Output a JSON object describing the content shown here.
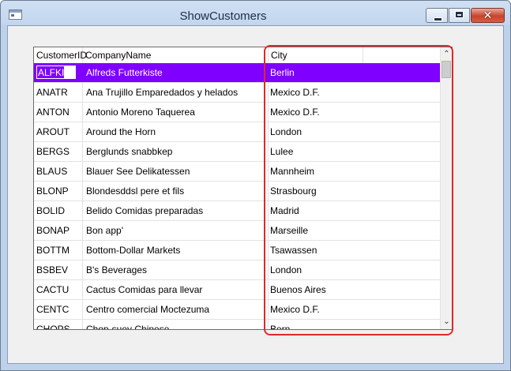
{
  "window": {
    "title": "ShowCustomers",
    "close_glyph": "✕",
    "icons": [
      "app-icon",
      "minimize-icon",
      "maximize-icon",
      "close-icon",
      "chevron-up-icon",
      "chevron-down-icon"
    ]
  },
  "grid": {
    "columns": [
      "CustomerID",
      "CompanyName",
      "City"
    ],
    "selected_color": "#7f00ff",
    "rows": [
      {
        "id": "ALFKI",
        "company": "Alfreds Futterkiste",
        "city": "Berlin"
      },
      {
        "id": "ANATR",
        "company": "Ana Trujillo Emparedados y helados",
        "city": "Mexico D.F."
      },
      {
        "id": "ANTON",
        "company": "Antonio Moreno Taquerea",
        "city": "Mexico D.F."
      },
      {
        "id": "AROUT",
        "company": "Around the Horn",
        "city": "London"
      },
      {
        "id": "BERGS",
        "company": "Berglunds snabbkep",
        "city": "Lulee"
      },
      {
        "id": "BLAUS",
        "company": "Blauer See Delikatessen",
        "city": "Mannheim"
      },
      {
        "id": "BLONP",
        "company": "Blondesddsl pere et fils",
        "city": "Strasbourg"
      },
      {
        "id": "BOLID",
        "company": "Belido Comidas preparadas",
        "city": "Madrid"
      },
      {
        "id": "BONAP",
        "company": "Bon app'",
        "city": "Marseille"
      },
      {
        "id": "BOTTM",
        "company": "Bottom-Dollar Markets",
        "city": "Tsawassen"
      },
      {
        "id": "BSBEV",
        "company": "B's Beverages",
        "city": "London"
      },
      {
        "id": "CACTU",
        "company": "Cactus Comidas para llevar",
        "city": "Buenos Aires"
      },
      {
        "id": "CENTC",
        "company": "Centro comercial Moctezuma",
        "city": "Mexico D.F."
      },
      {
        "id": "CHOPS",
        "company": "Chop-suey Chinese",
        "city": "Bern"
      }
    ]
  },
  "scrollbar": {
    "up_glyph": "⌃",
    "down_glyph": "⌄"
  },
  "annotation": {
    "color": "#e0282a"
  }
}
